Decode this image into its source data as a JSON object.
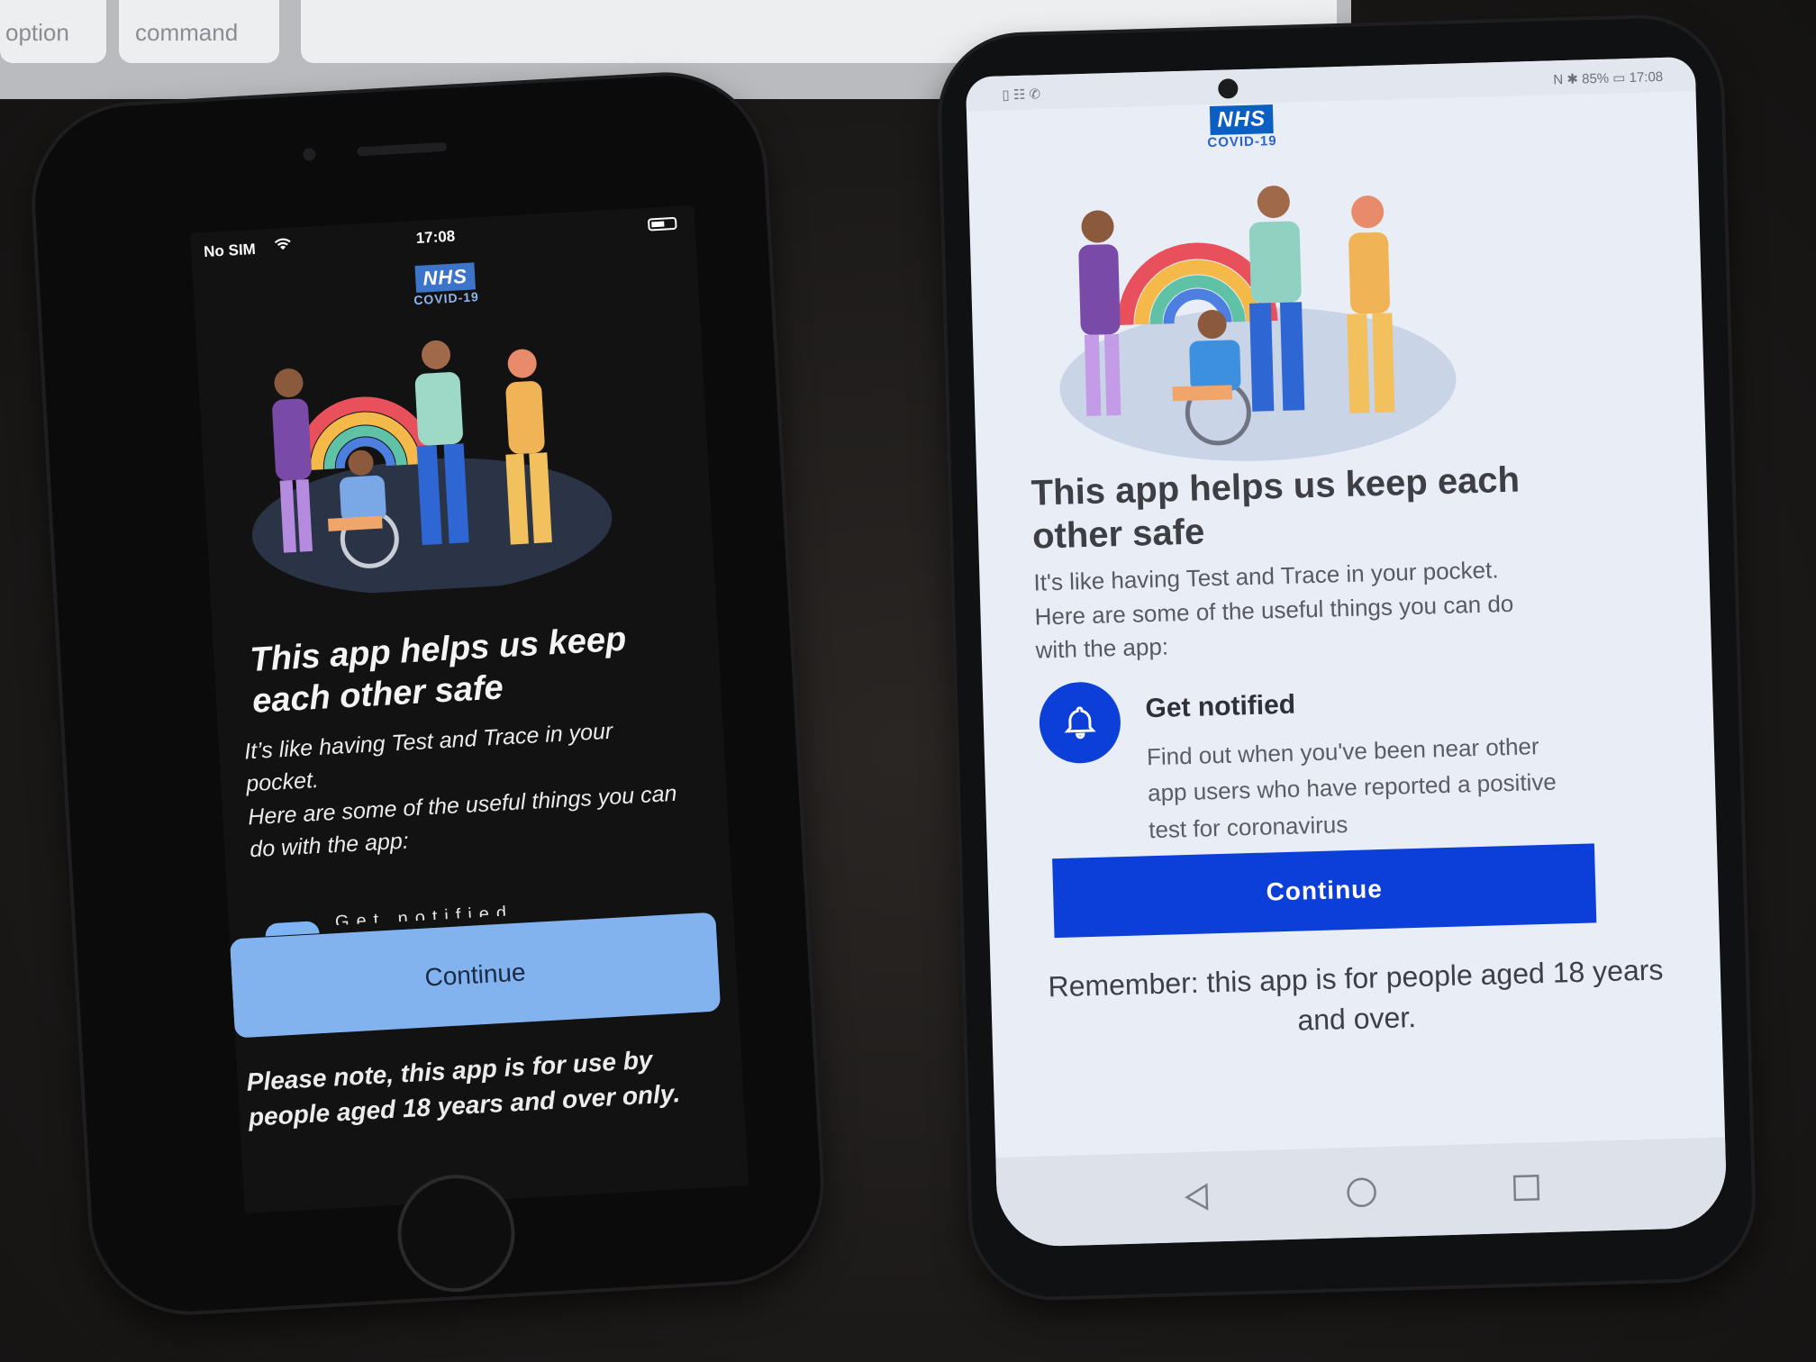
{
  "keyboard": {
    "option_key": "option",
    "command_key": "command"
  },
  "iphone": {
    "status": {
      "carrier": "No SIM",
      "clock": "17:08"
    },
    "logo": {
      "badge": "NHS",
      "sub": "COVID-19"
    },
    "heading": "This app helps us keep each other safe",
    "body_line1": "It’s like having Test and Trace in your pocket.",
    "body_line2": "Here are some of the useful things you can do with the app:",
    "feature_peek_title": "Get notified",
    "continue_label": "Continue",
    "footnote": "Please note, this app is for use by people aged 18 years and over only."
  },
  "android": {
    "status": {
      "left_icons": "▯ ☷ ✆",
      "right_text": "N ✱ 85% ▭ 17:08"
    },
    "logo": {
      "badge": "NHS",
      "sub": "COVID-19"
    },
    "heading": "This app helps us keep each other safe",
    "body": "It's like having Test and Trace in your pocket. Here are some of the useful things you can do with the app:",
    "feature": {
      "icon": "bell-icon",
      "title": "Get notified",
      "description": "Find out when you've been near other app users who have reported a positive test for coronavirus"
    },
    "continue_label": "Continue",
    "footnote": "Remember: this app is for people aged 18 years and over.",
    "navbar": {
      "back": "back-icon",
      "home": "home-circle-icon",
      "recents": "recents-square-icon"
    }
  },
  "colors": {
    "nhs_blue": "#0b5ec2",
    "android_button": "#0b3fd8",
    "iphone_button": "#82b3ef"
  }
}
